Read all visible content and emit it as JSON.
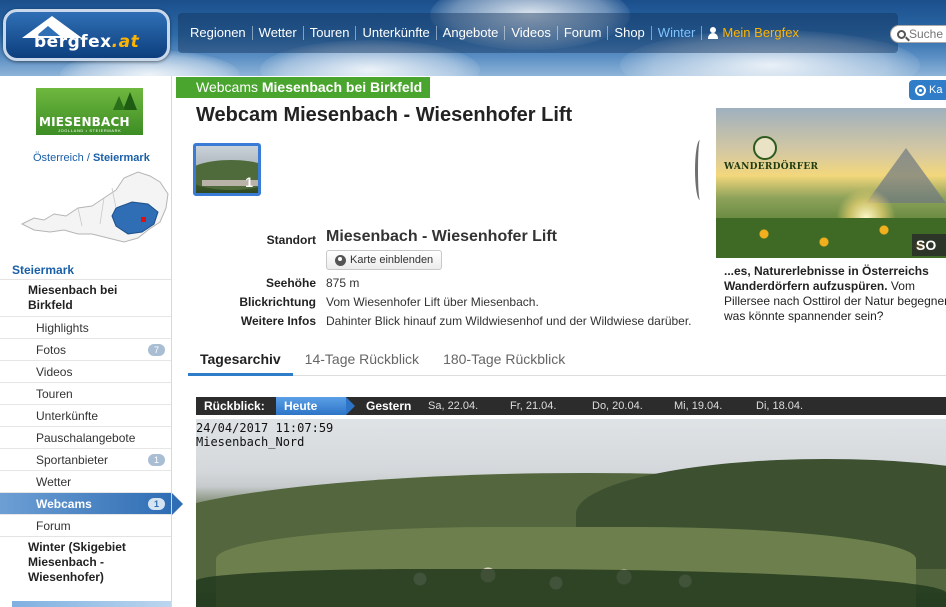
{
  "header": {
    "logo_text_a": "bergfex",
    "logo_text_b": ".at",
    "nav": [
      "Regionen",
      "Wetter",
      "Touren",
      "Unterkünfte",
      "Angebote",
      "Videos",
      "Forum",
      "Shop"
    ],
    "nav_winter": "Winter",
    "nav_account": "Mein Bergfex",
    "search_placeholder": "Suche"
  },
  "sidebar": {
    "region_logo_text": "MIESENBACH",
    "region_logo_sub": "JOGLLAND • STEIERMARK",
    "breadcrumb_country": "Österreich",
    "breadcrumb_sep": "/",
    "breadcrumb_state": "Steiermark",
    "menu_head": "Steiermark",
    "menu_sub": "Miesenbach bei Birkfeld",
    "items": [
      {
        "label": "Highlights",
        "count": ""
      },
      {
        "label": "Fotos",
        "count": "7"
      },
      {
        "label": "Videos",
        "count": ""
      },
      {
        "label": "Touren",
        "count": ""
      },
      {
        "label": "Unterkünfte",
        "count": ""
      },
      {
        "label": "Pauschalangebote",
        "count": ""
      },
      {
        "label": "Sportanbieter",
        "count": "1"
      },
      {
        "label": "Wetter",
        "count": ""
      },
      {
        "label": "Webcams",
        "count": "1"
      },
      {
        "label": "Forum",
        "count": ""
      }
    ],
    "winter_item": "Winter (Skigebiet Miesenbach - Wiesenhofer)"
  },
  "main": {
    "banner_prefix": "Webcams",
    "banner_place": "Miesenbach bei Birkfeld",
    "title_prefix": "Webcam",
    "title_name": "Miesenbach - Wiesenhofer Lift",
    "kam_label": "Ka",
    "thumb_count": "1",
    "info": {
      "standort_label": "Standort",
      "standort_value": "Miesenbach - Wiesenhofer Lift",
      "karte_button": "Karte einblenden",
      "seehoehe_label": "Seehöhe",
      "seehoehe_value": "875 m",
      "blick_label": "Blickrichtung",
      "blick_value": "Vom Wiesenhofer Lift über Miesenbach.",
      "weitere_label": "Weitere Infos",
      "weitere_value": "Dahinter Blick hinauf zum Wildwiesenhof und der Wildwiese darüber."
    },
    "tabs": [
      "Tagesarchiv",
      "14-Tage Rückblick",
      "180-Tage Rückblick"
    ],
    "rueckblick": {
      "label": "Rückblick:",
      "today": "Heute",
      "yesterday": "Gestern",
      "days": [
        "Sa, 22.04.",
        "Fr, 21.04.",
        "Do, 20.04.",
        "Mi, 19.04.",
        "Di, 18.04."
      ]
    },
    "cam_stamp_line1": "24/04/2017 11:07:59",
    "cam_stamp_line2": "Miesenbach_Nord"
  },
  "ad": {
    "brand": "WANDERDÖRFER",
    "tag": "SO SC",
    "text_bold": "...es, Naturerlebnisse in Österreichs Wanderdörfern aufzuspüren.",
    "text_rest": "Vom Pillersee nach Osttirol der Natur begegnen, was könnte spannender sein?"
  }
}
